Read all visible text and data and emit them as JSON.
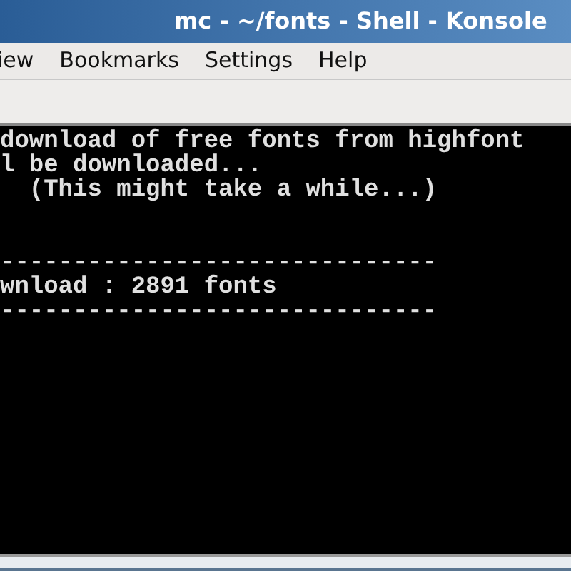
{
  "window": {
    "title": "mc - ~/fonts - Shell - Konsole"
  },
  "menu": [
    "iew",
    "Bookmarks",
    "Settings",
    "Help"
  ],
  "terminal": {
    "messages": [
      "download of free fonts from highfont",
      "l be downloaded...",
      "  (This might take a while...)"
    ],
    "summary": [
      "------------------------------",
      "wnload : 2891 fonts",
      "------------------------------"
    ]
  }
}
